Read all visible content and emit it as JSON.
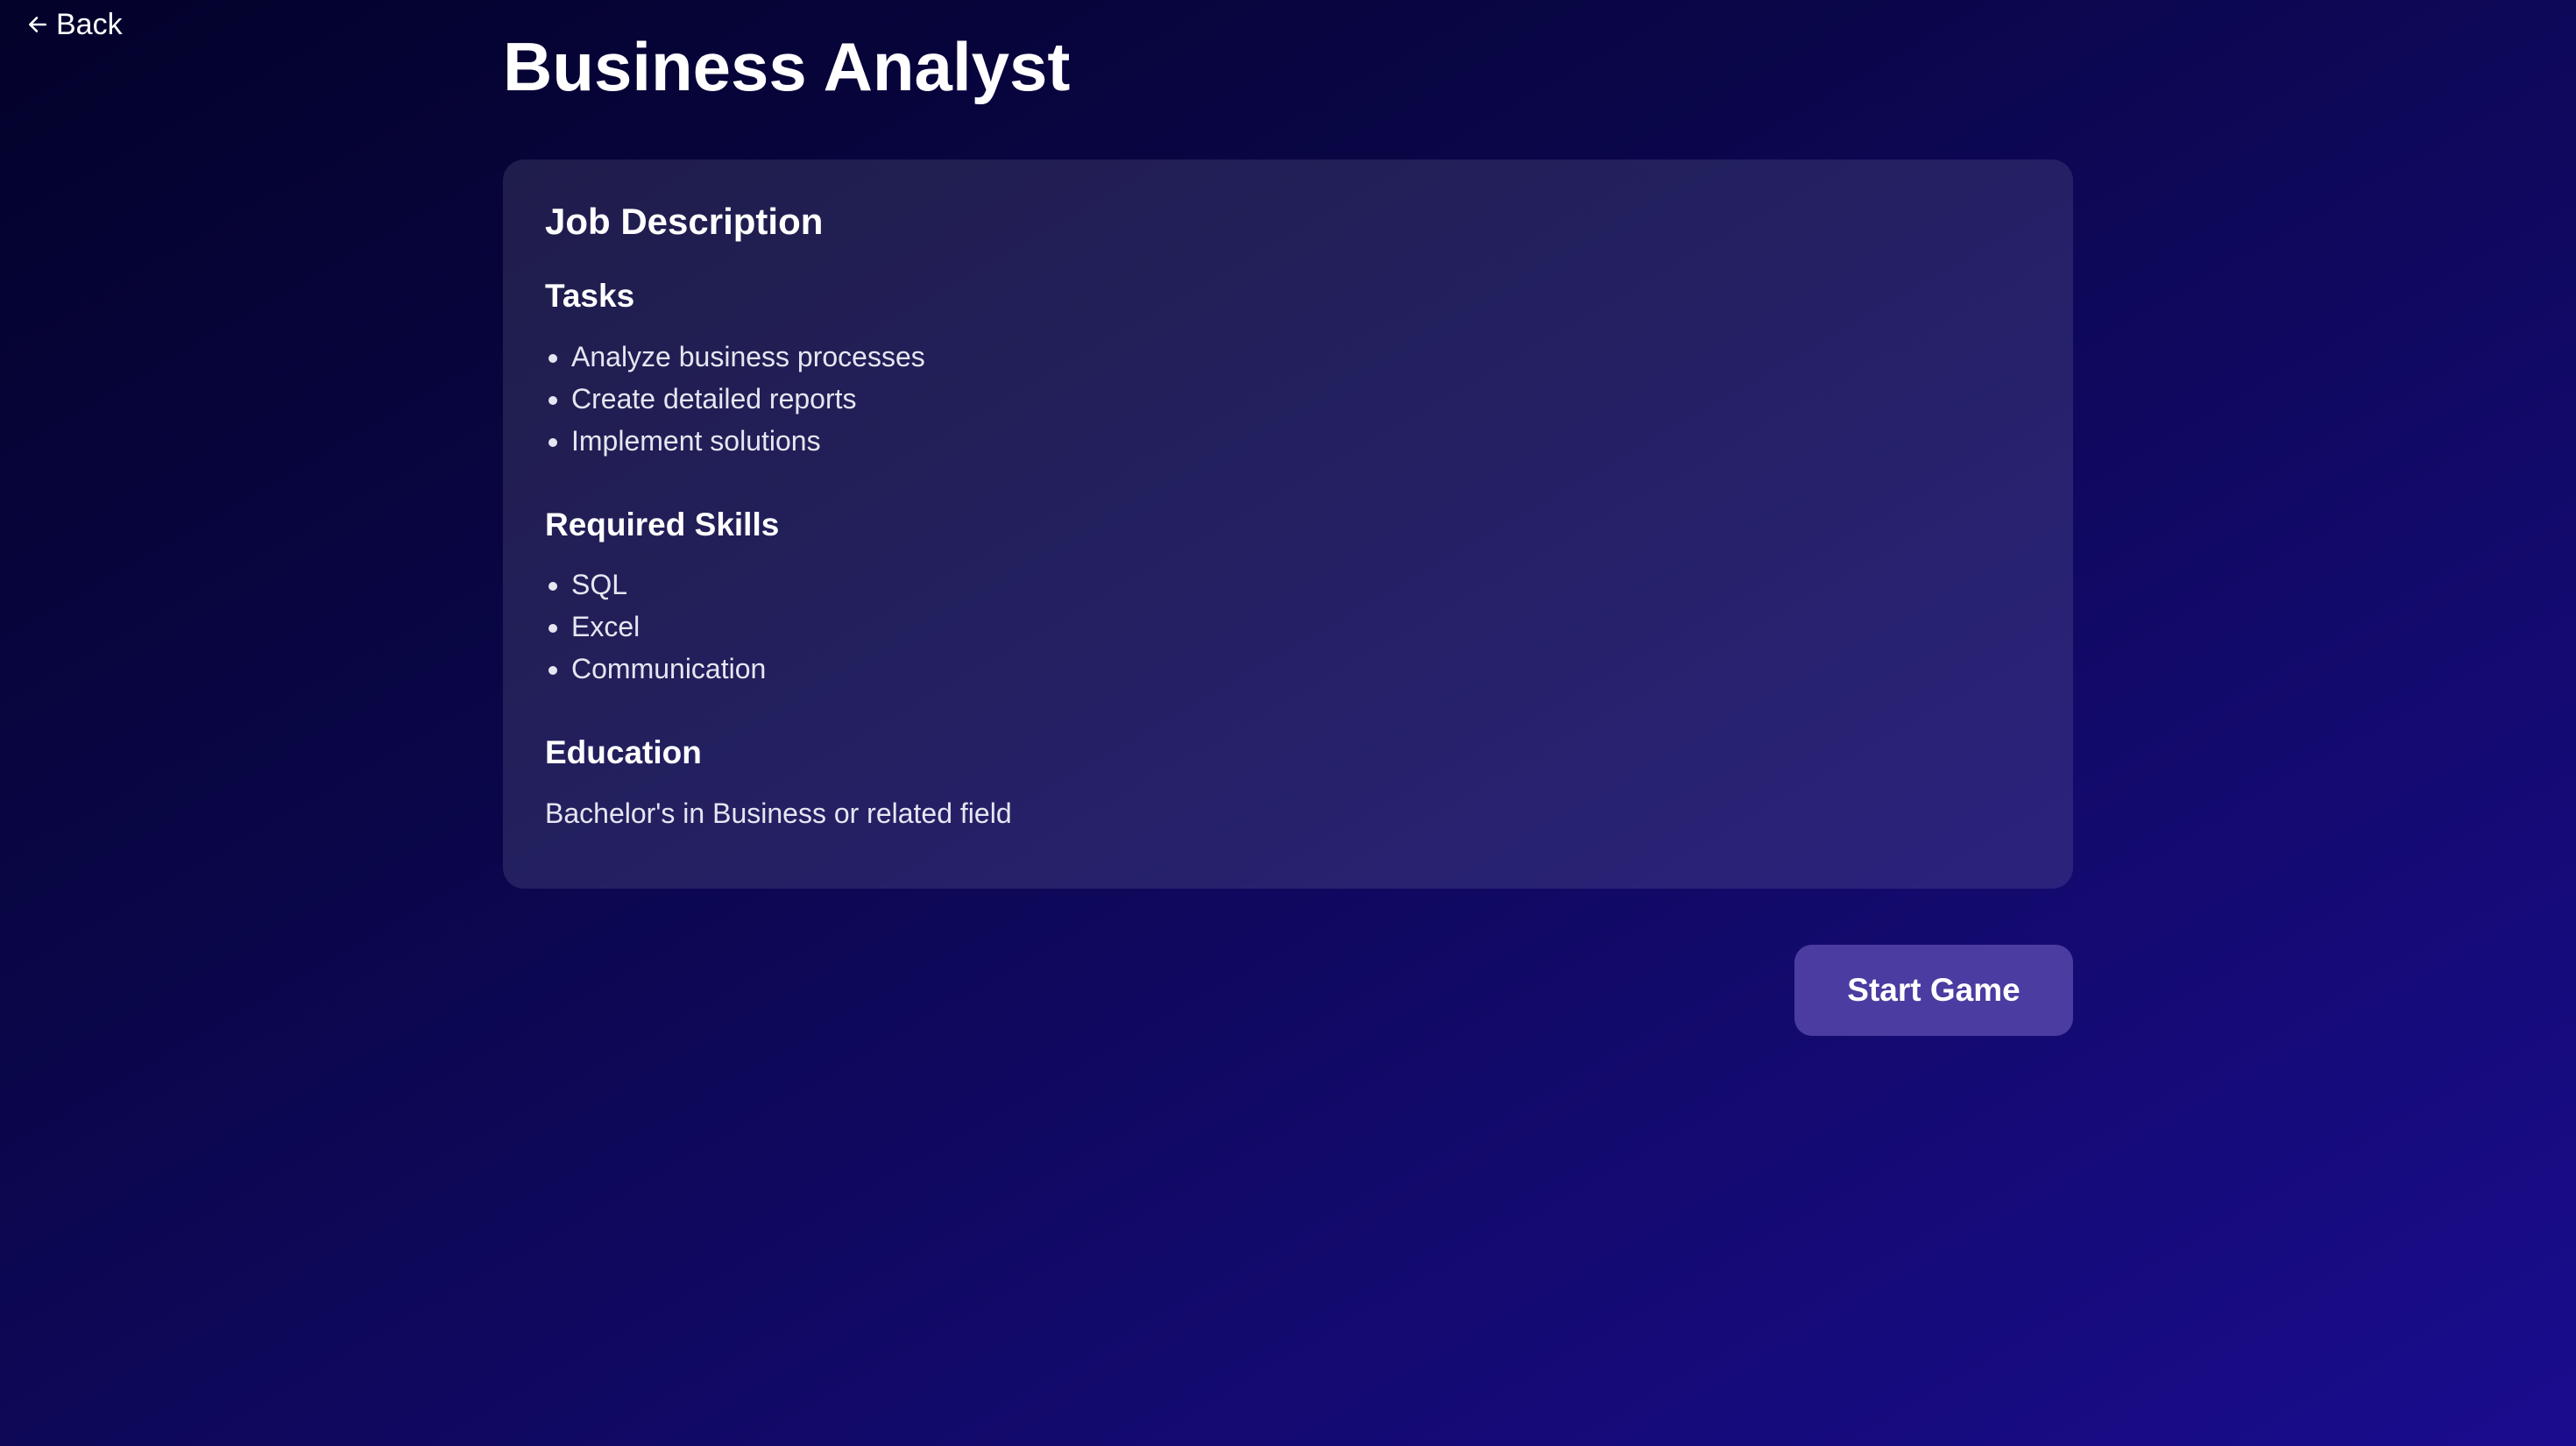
{
  "nav": {
    "back_label": "Back",
    "back_icon": "arrow-left-icon"
  },
  "page": {
    "title": "Business Analyst"
  },
  "job": {
    "heading": "Job Description",
    "tasks": {
      "heading": "Tasks",
      "items": [
        "Analyze business processes",
        "Create detailed reports",
        "Implement solutions"
      ]
    },
    "skills": {
      "heading": "Required Skills",
      "items": [
        "SQL",
        "Excel",
        "Communication"
      ]
    },
    "education": {
      "heading": "Education",
      "text": "Bachelor's in Business or related field"
    }
  },
  "actions": {
    "start_label": "Start Game"
  },
  "colors": {
    "background_start": "#03022a",
    "background_end": "#1a0c8e",
    "button": "#4a3ca0",
    "text": "#ffffff"
  }
}
